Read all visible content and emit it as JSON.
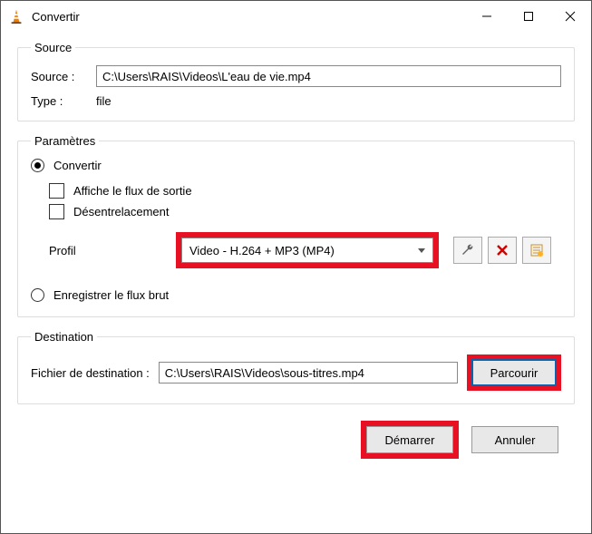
{
  "window": {
    "title": "Convertir"
  },
  "source": {
    "legend": "Source",
    "source_label": "Source :",
    "source_value": "C:\\Users\\RAIS\\Videos\\L'eau de vie.mp4",
    "type_label": "Type :",
    "type_value": "file"
  },
  "params": {
    "legend": "Paramètres",
    "convert_label": "Convertir",
    "show_output_label": "Affiche le flux de sortie",
    "deinterlace_label": "Désentrelacement",
    "profile_label": "Profil",
    "profile_value": "Video - H.264 + MP3 (MP4)",
    "raw_label": "Enregistrer le flux brut"
  },
  "dest": {
    "legend": "Destination",
    "label": "Fichier de destination :",
    "value": "C:\\Users\\RAIS\\Videos\\sous-titres.mp4",
    "browse_label": "Parcourir"
  },
  "footer": {
    "start_label": "Démarrer",
    "cancel_label": "Annuler"
  },
  "icons": {
    "wrench": "wrench-icon",
    "delete": "delete-icon",
    "new": "new-profile-icon"
  }
}
